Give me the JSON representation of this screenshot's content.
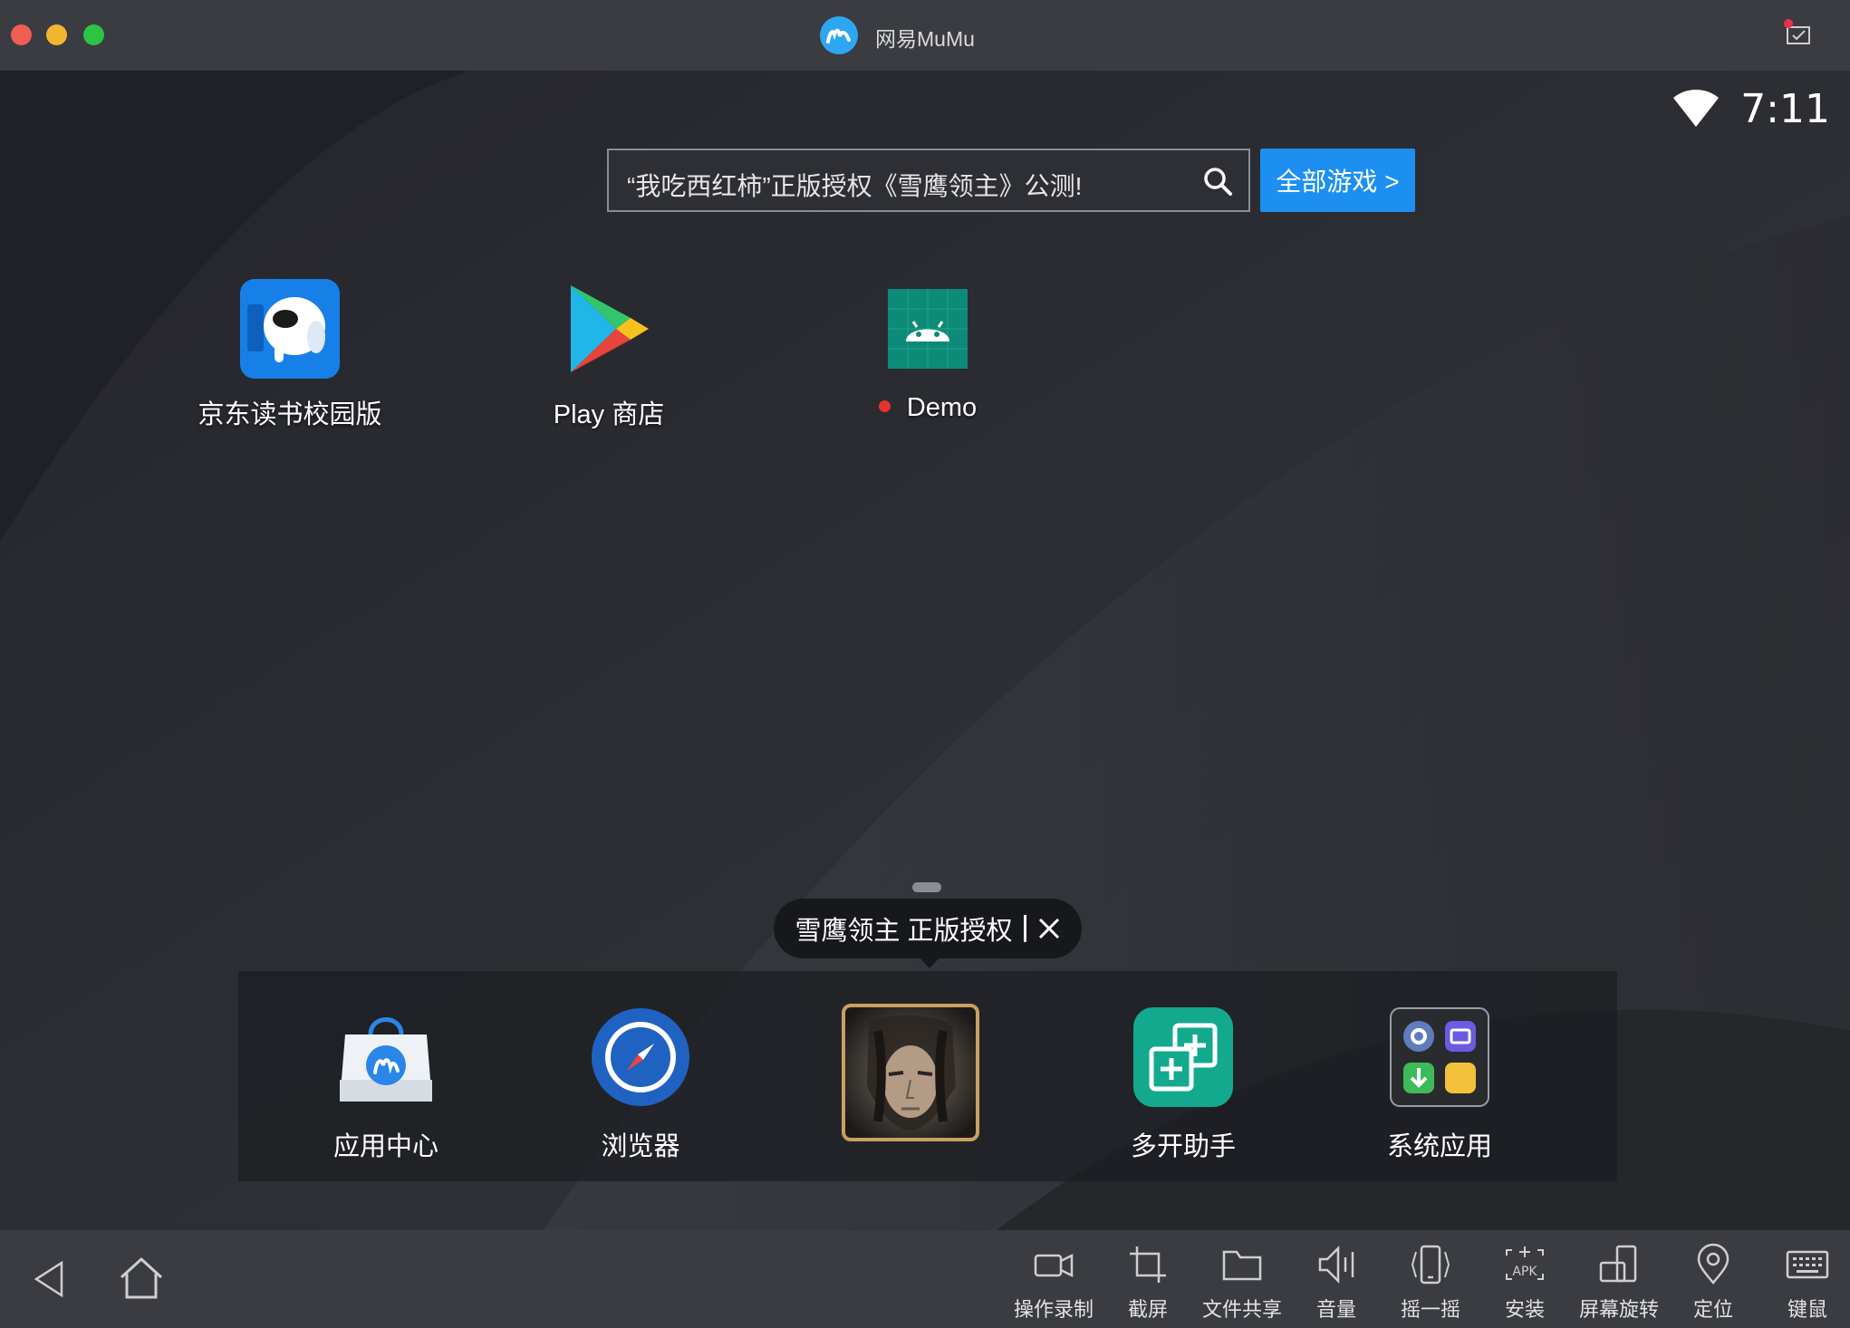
{
  "window": {
    "title": "网易MuMu"
  },
  "status_bar": {
    "time": "7:11"
  },
  "search": {
    "text": "“我吃西红柿”正版授权《雪鹰领主》公测!",
    "all_games_label": "全部游戏 >"
  },
  "desktop_apps": [
    {
      "label": "京东读书校园版",
      "icon": "jd-read-icon"
    },
    {
      "label": "Play 商店",
      "icon": "play-store-icon"
    },
    {
      "label": "Demo",
      "icon": "android-demo-icon",
      "badge": "new-dot"
    }
  ],
  "tooltip": {
    "text": "雪鹰领主 正版授权"
  },
  "dock_apps": [
    {
      "label": "应用中心",
      "icon": "app-center-icon"
    },
    {
      "label": "浏览器",
      "icon": "browser-icon"
    },
    {
      "label": "",
      "icon": "game-xueying-icon"
    },
    {
      "label": "多开助手",
      "icon": "multi-instance-icon"
    },
    {
      "label": "系统应用",
      "icon": "system-apps-icon"
    }
  ],
  "toolbar": {
    "tools": [
      {
        "label": "操作录制",
        "icon": "record-icon"
      },
      {
        "label": "截屏",
        "icon": "crop-icon"
      },
      {
        "label": "文件共享",
        "icon": "folder-icon"
      },
      {
        "label": "音量",
        "icon": "volume-icon"
      },
      {
        "label": "摇一摇",
        "icon": "shake-icon"
      },
      {
        "label": "安装",
        "icon": "apk-install-icon"
      },
      {
        "label": "屏幕旋转",
        "icon": "rotate-icon"
      },
      {
        "label": "定位",
        "icon": "location-icon"
      },
      {
        "label": "键鼠",
        "icon": "keyboard-icon"
      }
    ]
  },
  "colors": {
    "accent": "#1d8ff0",
    "titlebar": "#3a3c41",
    "screen_bg": "#2b2c31"
  }
}
